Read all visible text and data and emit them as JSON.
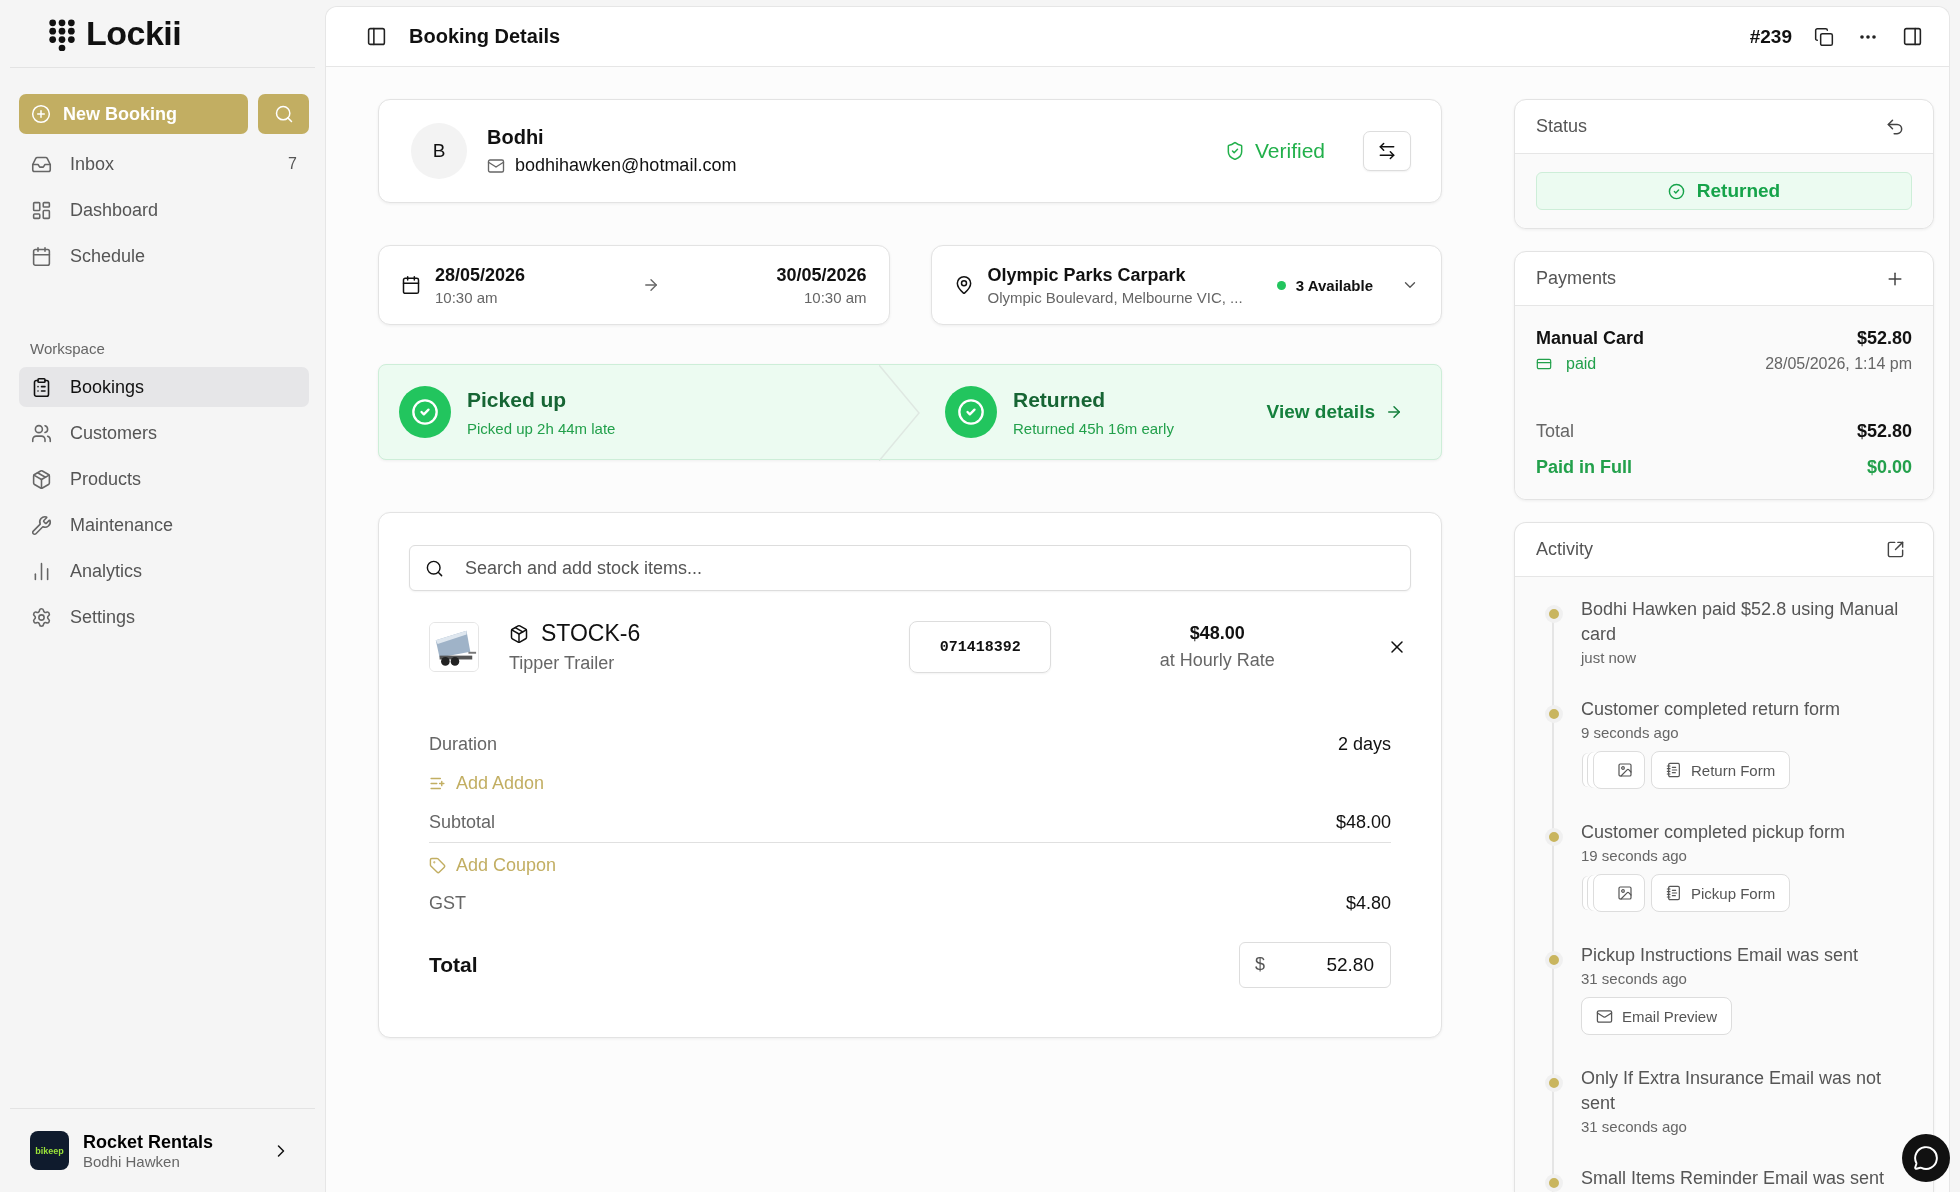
{
  "sidebar": {
    "logo": "Lockii",
    "new_booking": "New Booking",
    "nav": [
      {
        "label": "Inbox",
        "count": "7",
        "selected": false
      },
      {
        "label": "Dashboard",
        "selected": false
      },
      {
        "label": "Schedule",
        "selected": false
      }
    ],
    "section": "Workspace",
    "workspace": [
      {
        "label": "Bookings",
        "selected": true
      },
      {
        "label": "Customers",
        "selected": false
      },
      {
        "label": "Products",
        "selected": false
      },
      {
        "label": "Maintenance",
        "selected": false
      },
      {
        "label": "Analytics",
        "selected": false
      },
      {
        "label": "Settings",
        "selected": false
      }
    ],
    "account": {
      "badge": "bikeep",
      "name": "Rocket Rentals",
      "user": "Bodhi Hawken"
    }
  },
  "header": {
    "title": "Booking Details",
    "number": "#239"
  },
  "customer": {
    "initial": "B",
    "name": "Bodhi",
    "email": "bodhihawken@hotmail.com",
    "status": "Verified"
  },
  "dates": {
    "start_date": "28/05/2026",
    "start_time": "10:30 am",
    "end_date": "30/05/2026",
    "end_time": "10:30 am"
  },
  "location": {
    "name": "Olympic Parks Carpark",
    "address": "Olympic Boulevard, Melbourne VIC, ...",
    "availability": "3 Available"
  },
  "progress": {
    "steps": [
      {
        "title": "Picked up",
        "note": "Picked up 2h 44m late",
        "done": true
      },
      {
        "title": "Returned",
        "note": "Returned 45h 16m early",
        "done": true
      }
    ],
    "link": "View details"
  },
  "stock": {
    "search_placeholder": "Search and add stock items...",
    "items": [
      {
        "code": "STOCK-6",
        "name": "Tipper Trailer",
        "serial": "071418392",
        "price": "$48.00",
        "rate": "at Hourly Rate"
      }
    ],
    "duration_label": "Duration",
    "duration": "2 days",
    "add_addon": "Add Addon",
    "subtotal_label": "Subtotal",
    "subtotal": "$48.00",
    "add_coupon": "Add Coupon",
    "gst_label": "GST",
    "gst": "$4.80",
    "total_label": "Total",
    "currency": "$",
    "total": "52.80"
  },
  "status": {
    "title": "Status",
    "value": "Returned"
  },
  "payments": {
    "title": "Payments",
    "entries": [
      {
        "method": "Manual Card",
        "amount": "$52.80",
        "state": "paid",
        "date": "28/05/2026, 1:14 pm"
      }
    ],
    "total_label": "Total",
    "total": "$52.80",
    "balance_label": "Paid in Full",
    "balance": "$0.00"
  },
  "activity": {
    "title": "Activity",
    "items": [
      {
        "text": "Bodhi Hawken paid $52.8 using Manual card",
        "time": "just now"
      },
      {
        "text": "Customer completed return form",
        "time": "9 seconds ago",
        "attachments": [
          {
            "kind": "photos"
          },
          {
            "kind": "form",
            "label": "Return Form"
          }
        ]
      },
      {
        "text": "Customer completed pickup form",
        "time": "19 seconds ago",
        "attachments": [
          {
            "kind": "photos"
          },
          {
            "kind": "form",
            "label": "Pickup Form"
          }
        ]
      },
      {
        "text": "Pickup Instructions Email was sent",
        "time": "31 seconds ago",
        "attachments": [
          {
            "kind": "email",
            "label": "Email Preview"
          }
        ]
      },
      {
        "text": "Only If Extra Insurance Email was not sent",
        "time": "31 seconds ago"
      },
      {
        "text": "Small Items Reminder Email was sent"
      }
    ]
  }
}
